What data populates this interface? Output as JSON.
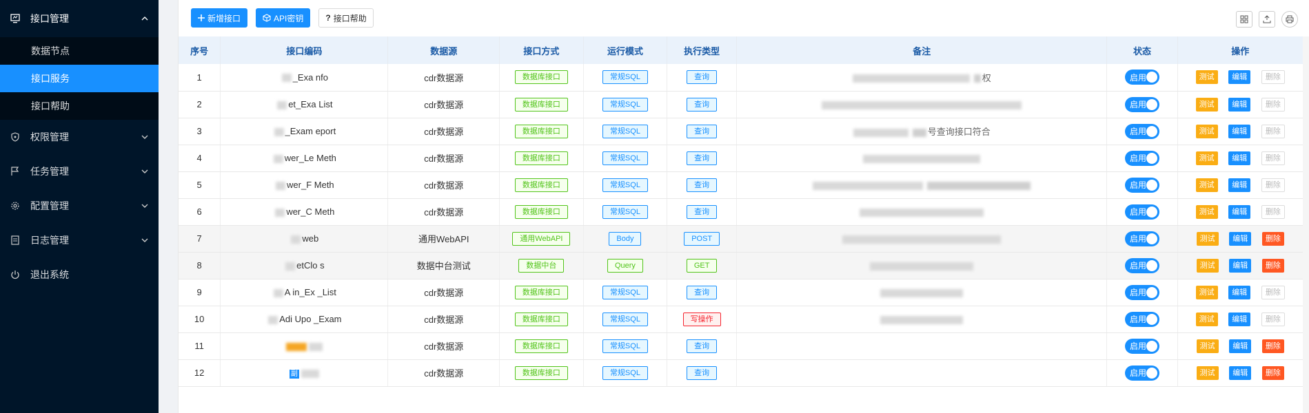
{
  "sidebar": {
    "groups": [
      {
        "label": "接口管理",
        "icon": "monitor-icon",
        "open": true
      },
      {
        "label": "权限管理",
        "icon": "shield-icon"
      },
      {
        "label": "任务管理",
        "icon": "flag-icon"
      },
      {
        "label": "配置管理",
        "icon": "gear-icon"
      },
      {
        "label": "日志管理",
        "icon": "document-icon"
      },
      {
        "label": "退出系统",
        "icon": "power-icon"
      }
    ],
    "subitems": [
      {
        "label": "数据节点"
      },
      {
        "label": "接口服务",
        "active": true
      },
      {
        "label": "接口帮助"
      }
    ]
  },
  "toolbar": {
    "add_label": "新增接口",
    "api_key_label": "API密钥",
    "help_label": "接口帮助"
  },
  "table": {
    "headers": [
      "序号",
      "接口编码",
      "数据源",
      "接口方式",
      "运行模式",
      "执行类型",
      "备注",
      "状态",
      "操作"
    ],
    "rows": [
      {
        "no": "1",
        "code": "_Exa  nfo",
        "source": "cdr数据源",
        "method": "数据库接口",
        "mode": "常规SQL",
        "exec": "查询",
        "exec_color": "blue",
        "remark_tail": "权",
        "status": "启用",
        "del_enabled": false
      },
      {
        "no": "2",
        "code": "et_Exa  List",
        "source": "cdr数据源",
        "method": "数据库接口",
        "mode": "常规SQL",
        "exec": "查询",
        "exec_color": "blue",
        "remark_tail": "",
        "status": "启用",
        "del_enabled": false
      },
      {
        "no": "3",
        "code": "_Exam  eport",
        "source": "cdr数据源",
        "method": "数据库接口",
        "mode": "常规SQL",
        "exec": "查询",
        "exec_color": "blue",
        "remark_tail": "号查询接口符合",
        "status": "启用",
        "del_enabled": false
      },
      {
        "no": "4",
        "code": "wer_Le  Meth",
        "source": "cdr数据源",
        "method": "数据库接口",
        "mode": "常规SQL",
        "exec": "查询",
        "exec_color": "blue",
        "remark_tail": "",
        "status": "启用",
        "del_enabled": false
      },
      {
        "no": "5",
        "code": "wer_F  Meth",
        "source": "cdr数据源",
        "method": "数据库接口",
        "mode": "常规SQL",
        "exec": "查询",
        "exec_color": "blue",
        "remark_tail": "",
        "status": "启用",
        "del_enabled": false
      },
      {
        "no": "6",
        "code": "wer_C  Meth",
        "source": "cdr数据源",
        "method": "数据库接口",
        "mode": "常规SQL",
        "exec": "查询",
        "exec_color": "blue",
        "remark_tail": "",
        "status": "启用",
        "del_enabled": false
      },
      {
        "no": "7",
        "code": "web",
        "source": "通用WebAPI",
        "method": "通用WebAPI",
        "mode": "Body",
        "exec": "POST",
        "exec_color": "blue",
        "remark_tail": "",
        "status": "启用",
        "del_enabled": true
      },
      {
        "no": "8",
        "code": "etClo  s",
        "source": "数据中台测试",
        "method": "数据中台",
        "mode": "Query",
        "exec": "GET",
        "exec_color": "green",
        "remark_tail": "",
        "status": "启用",
        "del_enabled": true
      },
      {
        "no": "9",
        "code": "A  in_Ex  _List",
        "source": "cdr数据源",
        "method": "数据库接口",
        "mode": "常规SQL",
        "exec": "查询",
        "exec_color": "blue",
        "remark_tail": "",
        "status": "启用",
        "del_enabled": false
      },
      {
        "no": "10",
        "code": "Adi  Upo  _Exam",
        "source": "cdr数据源",
        "method": "数据库接口",
        "mode": "常规SQL",
        "exec": "写操作",
        "exec_color": "red",
        "remark_tail": "",
        "status": "启用",
        "del_enabled": false
      },
      {
        "no": "11",
        "code": "",
        "source": "cdr数据源",
        "method": "数据库接口",
        "mode": "常规SQL",
        "exec": "查询",
        "exec_color": "blue",
        "remark_tail": "",
        "status": "启用",
        "del_enabled": true
      },
      {
        "no": "12",
        "code": "副",
        "source": "cdr数据源",
        "method": "数据库接口",
        "mode": "常规SQL",
        "exec": "查询",
        "exec_color": "blue",
        "remark_tail": "",
        "status": "启用",
        "del_enabled": true
      }
    ],
    "action_labels": {
      "test": "测试",
      "edit": "编辑",
      "delete": "删除"
    }
  },
  "colors": {
    "sidebar_bg": "#001529",
    "accent": "#1890ff",
    "warn": "#faad14",
    "danger": "#ff5722"
  }
}
